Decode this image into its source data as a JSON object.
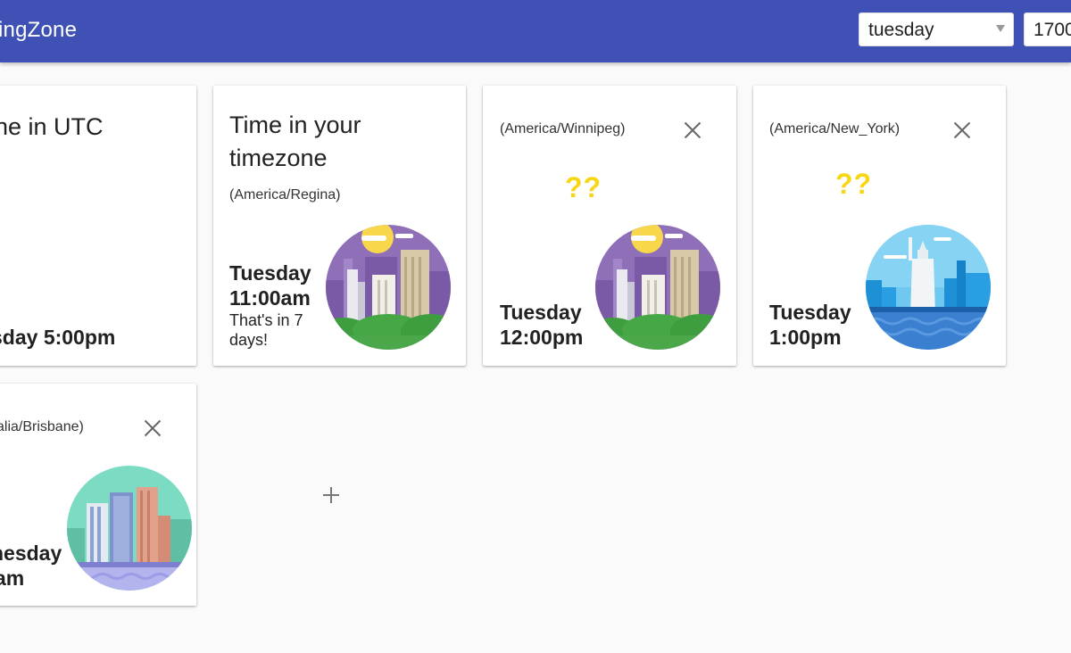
{
  "app": {
    "title": "ingZone"
  },
  "controls": {
    "day_value": "tuesday",
    "time_value": "1700"
  },
  "cards": [
    {
      "title": "ne in UTC",
      "time": "sday 5:00pm"
    },
    {
      "title_line1": "Time in your",
      "title_line2": "timezone",
      "zone": "(America/Regina)",
      "day": "Tuesday",
      "time": "11:00am",
      "note": "That's in 7 days!"
    },
    {
      "zone": "(America/Winnipeg)",
      "unknown": "??",
      "day": "Tuesday",
      "time": "12:00pm",
      "close_icon": "close-icon"
    },
    {
      "zone": "(America/New_York)",
      "unknown": "??",
      "day": "Tuesday",
      "time": "1:00pm",
      "close_icon": "close-icon"
    },
    {
      "zone": "alia/Brisbane)",
      "day": "nesday",
      "time": "am",
      "close_icon": "close-icon"
    }
  ],
  "add": {
    "icon": "plus-icon"
  },
  "colors": {
    "appbar": "#3f51b5",
    "unknown_marks": "#f7d715"
  }
}
